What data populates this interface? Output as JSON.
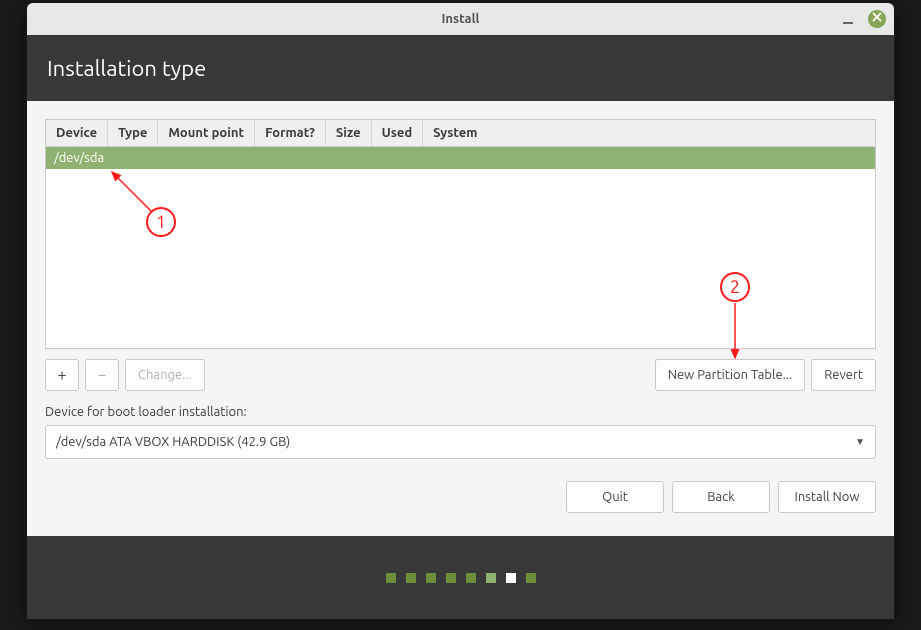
{
  "window": {
    "title": "Install"
  },
  "header": {
    "title": "Installation type"
  },
  "table": {
    "columns": [
      "Device",
      "Type",
      "Mount point",
      "Format?",
      "Size",
      "Used",
      "System"
    ],
    "rows": [
      {
        "device": "/dev/sda",
        "type": "",
        "mount": "",
        "format": "",
        "size": "",
        "used": "",
        "system": ""
      }
    ]
  },
  "toolbar": {
    "add": "+",
    "remove": "−",
    "change": "Change...",
    "new_partition": "New Partition Table...",
    "revert": "Revert"
  },
  "bootloader": {
    "label": "Device for boot loader installation:",
    "value": "/dev/sda ATA VBOX HARDDISK (42.9 GB)"
  },
  "footer": {
    "quit": "Quit",
    "back": "Back",
    "install": "Install Now"
  },
  "annotations": {
    "a1": "1",
    "a2": "2"
  }
}
